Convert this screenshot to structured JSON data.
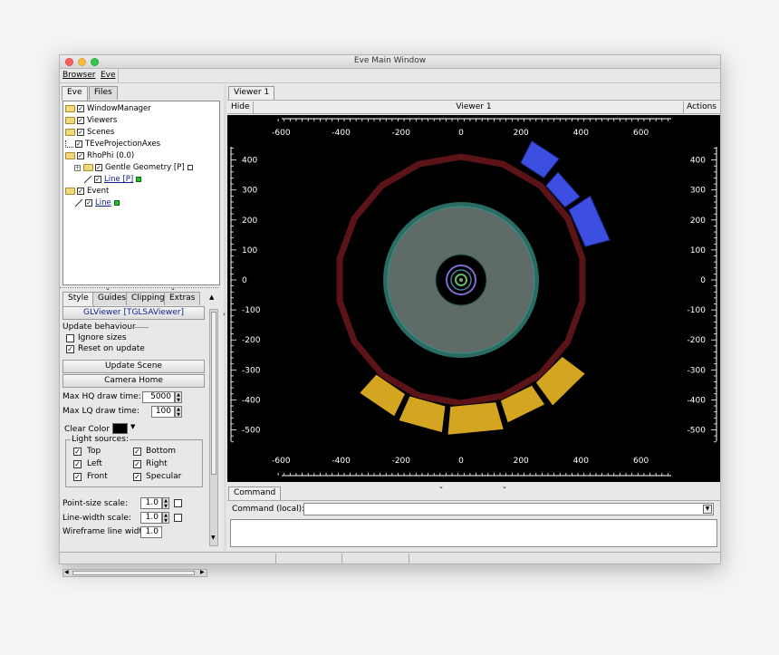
{
  "window": {
    "title": "Eve Main Window"
  },
  "menubar": {
    "browser": "Browser",
    "eve": "Eve"
  },
  "left_tabs": {
    "eve": "Eve",
    "files": "Files"
  },
  "tree": [
    {
      "label": "WindowManager",
      "indent": 0,
      "icon": "folder-icon",
      "checked": true
    },
    {
      "label": "Viewers",
      "indent": 0,
      "icon": "folder-icon",
      "checked": true
    },
    {
      "label": "Scenes",
      "indent": 0,
      "icon": "folder-icon",
      "checked": true
    },
    {
      "label": "TEveProjectionAxes",
      "indent": 0,
      "icon": "axes-icon",
      "checked": true
    },
    {
      "label": "RhoPhi (0.0)",
      "indent": 0,
      "icon": "folder-open-icon",
      "checked": true
    },
    {
      "label": "Gentle Geometry [P]",
      "indent": 1,
      "icon": "folder-icon",
      "checked": true,
      "marker": "white"
    },
    {
      "label": "Line [P]",
      "indent": 2,
      "icon": "line-icon",
      "checked": true,
      "marker": "green",
      "link": true
    },
    {
      "label": "Event",
      "indent": 0,
      "icon": "folder-open-icon",
      "checked": true
    },
    {
      "label": "Line",
      "indent": 1,
      "icon": "line-icon",
      "checked": true,
      "marker": "green",
      "link": true
    }
  ],
  "editor_tabs": {
    "style": "Style",
    "guides": "Guides",
    "clipping": "Clipping",
    "extras": "Extras"
  },
  "editor": {
    "header": "GLViewer [TGLSAViewer]",
    "update_behaviour": "Update behaviour",
    "ignore_sizes": "Ignore sizes",
    "reset_on_update": "Reset on update",
    "update_scene": "Update Scene",
    "camera_home": "Camera Home",
    "max_hq_label": "Max HQ draw time:",
    "max_hq_value": "5000",
    "max_lq_label": "Max LQ draw time:",
    "max_lq_value": "100",
    "clear_color": "Clear Color",
    "light_sources": "Light sources:",
    "top": "Top",
    "bottom": "Bottom",
    "left": "Left",
    "right": "Right",
    "front": "Front",
    "specular": "Specular",
    "point_size_label": "Point-size scale:",
    "point_size_value": "1.0",
    "line_width_label": "Line-width scale:",
    "line_width_value": "1.0",
    "wireframe_label": "Wireframe line width",
    "wireframe_value": "1.0"
  },
  "viewer": {
    "tab": "Viewer 1",
    "hide": "Hide",
    "title": "Viewer 1",
    "actions": "Actions",
    "x_ticks": [
      "-600",
      "-400",
      "-200",
      "0",
      "200",
      "400",
      "600"
    ],
    "y_ticks": [
      "400",
      "300",
      "200",
      "100",
      "0",
      "-100",
      "-200",
      "-300",
      "-400",
      "-500"
    ]
  },
  "command": {
    "tab": "Command",
    "label": "Command (local):"
  }
}
